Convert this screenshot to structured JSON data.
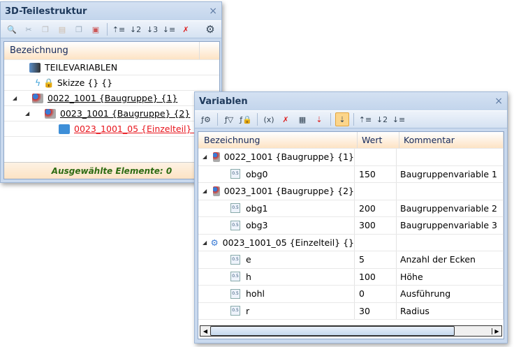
{
  "tree_window": {
    "title": "3D-Teilestruktur",
    "close": "×",
    "toolbar": [
      "magnifier-icon",
      "scissors-icon",
      "copy-icon",
      "paste-icon",
      "paste-special-icon",
      "paste-insert-icon",
      "expand-level-1-icon",
      "sort-2-icon",
      "sort-3-icon",
      "expand-all-icon",
      "clear-sort-icon",
      "gear-icon"
    ],
    "column_header": "Bezeichnung",
    "items": [
      {
        "label": "TEILEVARIABLEN"
      },
      {
        "label": "Skizze {} {}"
      },
      {
        "label": "0022_1001 {Baugruppe} {1}"
      },
      {
        "label": "0023_1001 {Baugruppe} {2}"
      },
      {
        "label": "0023_1001_05 {Einzelteil} {}"
      }
    ],
    "status": "Ausgewählte Elemente: 0"
  },
  "variables_window": {
    "title": "Variablen",
    "close": "×",
    "columns": [
      "Bezeichnung",
      "Wert",
      "Kommentar"
    ],
    "groups": [
      {
        "label": "0022_1001 {Baugruppe} {1}",
        "rows": [
          {
            "name": "obg0",
            "value": "150",
            "comment": "Baugruppenvariable 1"
          }
        ]
      },
      {
        "label": "0023_1001 {Baugruppe} {2}",
        "rows": [
          {
            "name": "obg1",
            "value": "200",
            "comment": "Baugruppenvariable 2"
          },
          {
            "name": "obg3",
            "value": "300",
            "comment": "Baugruppenvariable 3"
          }
        ]
      },
      {
        "label": "0023_1001_05 {Einzelteil} {}",
        "rows": [
          {
            "name": "e",
            "value": "5",
            "comment": "Anzahl der Ecken"
          },
          {
            "name": "h",
            "value": "100",
            "comment": "Höhe"
          },
          {
            "name": "hohl",
            "value": "0",
            "comment": "Ausführung"
          },
          {
            "name": "r",
            "value": "30",
            "comment": "Radius"
          }
        ]
      }
    ],
    "var_icon_text": "0.5"
  },
  "colors": {
    "link_red": "#e8141c",
    "status_green": "#2e6b12",
    "title_blue": "#1e395b"
  }
}
